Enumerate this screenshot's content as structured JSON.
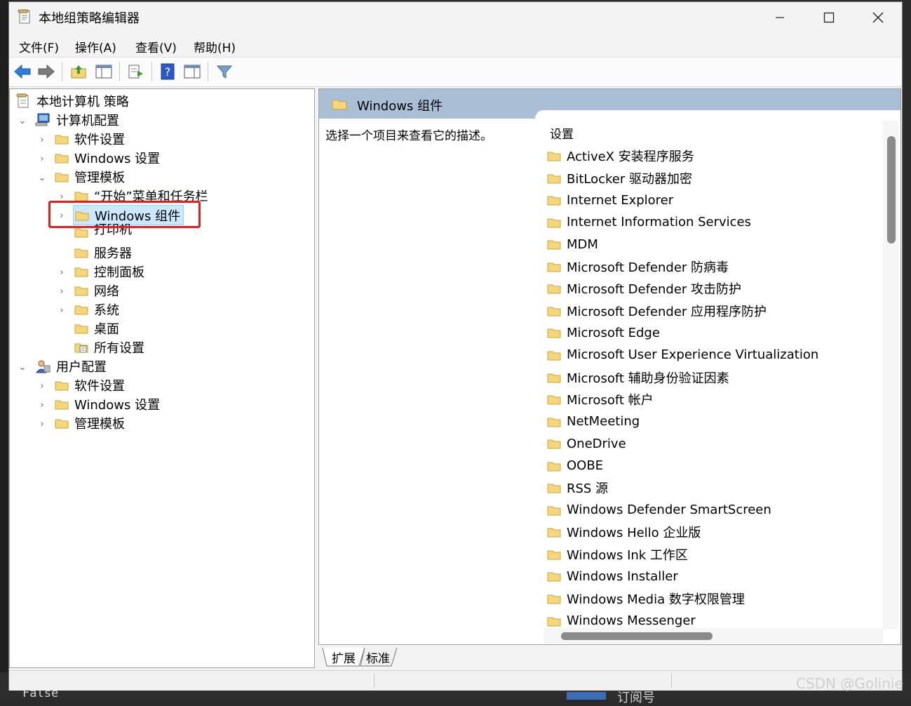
{
  "window": {
    "title": "本地组策略编辑器"
  },
  "menu": [
    "文件(F)",
    "操作(A)",
    "查看(V)",
    "帮助(H)"
  ],
  "toolbar": {
    "buttons": [
      "back-arrow-icon",
      "forward-arrow-icon",
      "up-folder-icon",
      "show-hide-tree-icon",
      "export-list-icon",
      "help-icon",
      "show-action-pane-icon",
      "filter-icon"
    ]
  },
  "tree": {
    "root": "本地计算机 策略",
    "computer_config": "计算机配置",
    "cc_software": "软件设置",
    "cc_windows": "Windows 设置",
    "cc_admin": "管理模板",
    "start_menu": "“开始”菜单和任务栏",
    "windows_components": "Windows 组件",
    "printers": "打印机",
    "server": "服务器",
    "control_panel": "控制面板",
    "network": "网络",
    "system": "系统",
    "desktop": "桌面",
    "all_settings": "所有设置",
    "user_config": "用户配置",
    "uc_software": "软件设置",
    "uc_windows": "Windows 设置",
    "uc_admin": "管理模板"
  },
  "right": {
    "header": "Windows 组件",
    "description": "选择一个项目来查看它的描述。",
    "column_header": "设置",
    "items": [
      "ActiveX 安装程序服务",
      "BitLocker 驱动器加密",
      "Internet Explorer",
      "Internet Information Services",
      "MDM",
      "Microsoft Defender 防病毒",
      "Microsoft Defender 攻击防护",
      "Microsoft Defender 应用程序防护",
      "Microsoft Edge",
      "Microsoft User Experience Virtualization",
      "Microsoft 辅助身份验证因素",
      "Microsoft 帐户",
      "NetMeeting",
      "OneDrive",
      "OOBE",
      "RSS 源",
      "Windows Defender SmartScreen",
      "Windows Hello 企业版",
      "Windows Ink 工作区",
      "Windows Installer",
      "Windows Media 数字权限管理",
      "Windows Messenger"
    ]
  },
  "tabs": [
    "扩展",
    "标准"
  ],
  "background": {
    "terminal_text": "False",
    "taskbar_text": "订阅号",
    "watermark": "CSDN @Golinie"
  },
  "colors": {
    "selection": "#cce8ff",
    "header": "#a9bfd6",
    "highlight_box": "#e81d1d",
    "folder": "#f5d77a"
  }
}
